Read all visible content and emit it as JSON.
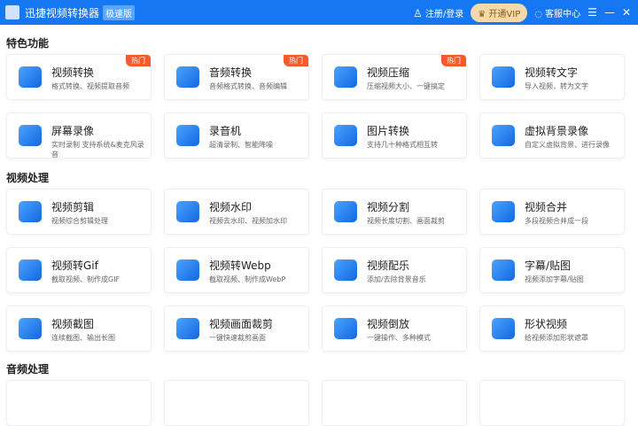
{
  "header": {
    "title": "迅捷视频转换器",
    "edition": "极速版",
    "login": "注册/登录",
    "vip": "开通VIP",
    "service": "客服中心"
  },
  "sections": [
    {
      "title": "特色功能",
      "items": [
        {
          "t": "视频转换",
          "s": "格式转换、视频提取音频",
          "hot": "热门"
        },
        {
          "t": "音频转换",
          "s": "音频格式转换、音频编辑",
          "hot": "热门"
        },
        {
          "t": "视频压缩",
          "s": "压缩视频大小、一键搞定",
          "hot": "热门"
        },
        {
          "t": "视频转文字",
          "s": "导入视频，转为文字"
        },
        {
          "t": "屏幕录像",
          "s": "实时录制 支持系统&麦克风录音"
        },
        {
          "t": "录音机",
          "s": "超清录制、智能降噪"
        },
        {
          "t": "图片转换",
          "s": "支持几十种格式相互转"
        },
        {
          "t": "虚拟背景录像",
          "s": "自定义虚拟背景、进行录像"
        }
      ]
    },
    {
      "title": "视频处理",
      "items": [
        {
          "t": "视频剪辑",
          "s": "视频综合剪辑处理"
        },
        {
          "t": "视频水印",
          "s": "视频去水印、视频加水印"
        },
        {
          "t": "视频分割",
          "s": "视频长度切割、画面裁剪"
        },
        {
          "t": "视频合并",
          "s": "多段视频合并成一段"
        },
        {
          "t": "视频转Gif",
          "s": "截取视频、制作成GIF"
        },
        {
          "t": "视频转Webp",
          "s": "截取视频、制作成WebP"
        },
        {
          "t": "视频配乐",
          "s": "添加/去除背景音乐"
        },
        {
          "t": "字幕/贴图",
          "s": "视频添加字幕/贴图"
        },
        {
          "t": "视频截图",
          "s": "连续截图、输出长图"
        },
        {
          "t": "视频画面裁剪",
          "s": "一键快速裁剪画面"
        },
        {
          "t": "视频倒放",
          "s": "一键操作、多种模式"
        },
        {
          "t": "形状视频",
          "s": "给视频添加形状遮罩"
        }
      ]
    },
    {
      "title": "音频处理",
      "items": []
    }
  ]
}
